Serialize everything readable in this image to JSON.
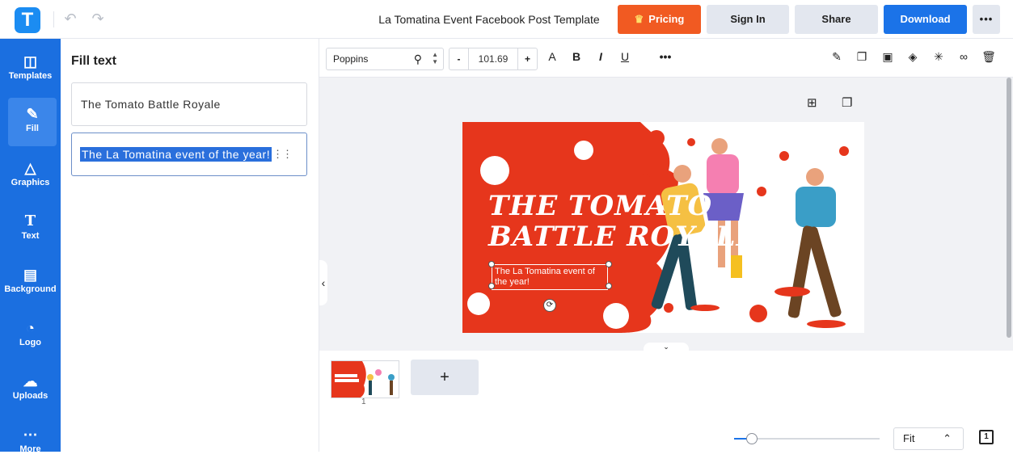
{
  "app": {
    "logo_letter": "T",
    "document_title": "La Tomatina Event Facebook Post Template",
    "brand_color": "#1b8cf2"
  },
  "header": {
    "undo_icon": "undo-icon",
    "redo_icon": "redo-icon",
    "pricing_label": "Pricing",
    "signin_label": "Sign In",
    "share_label": "Share",
    "download_label": "Download",
    "more_label": "•••"
  },
  "sidebar": {
    "items": [
      {
        "label": "Templates",
        "icon": "templates-icon"
      },
      {
        "label": "Fill",
        "icon": "pencil-icon"
      },
      {
        "label": "Graphics",
        "icon": "shapes-icon"
      },
      {
        "label": "Text",
        "icon": "text-icon"
      },
      {
        "label": "Background",
        "icon": "background-icon"
      },
      {
        "label": "Logo",
        "icon": "logo-icon"
      },
      {
        "label": "Uploads",
        "icon": "cloud-upload-icon"
      },
      {
        "label": "More",
        "icon": "more-icon"
      }
    ],
    "active": "Fill"
  },
  "fill_panel": {
    "title": "Fill text",
    "fields": [
      {
        "value": "The Tomato Battle Royale"
      },
      {
        "value": "The La Tomatina event of the year!"
      }
    ]
  },
  "toolbar": {
    "font_name": "Poppins",
    "font_size": "101.69",
    "minus_label": "-",
    "plus_label": "+",
    "format_buttons": [
      "A",
      "B",
      "I",
      "U"
    ],
    "more_label": "•••"
  },
  "design": {
    "title_line1": "THE TOMATO",
    "title_line2": "BATTLE ROYALE",
    "subtitle": "The La Tomatina event of the year!",
    "accent_color": "#e6361c"
  },
  "pages": {
    "current_page": "1",
    "add_label": "+",
    "zoom_label": "Fit",
    "zoom_level": 0.12
  }
}
